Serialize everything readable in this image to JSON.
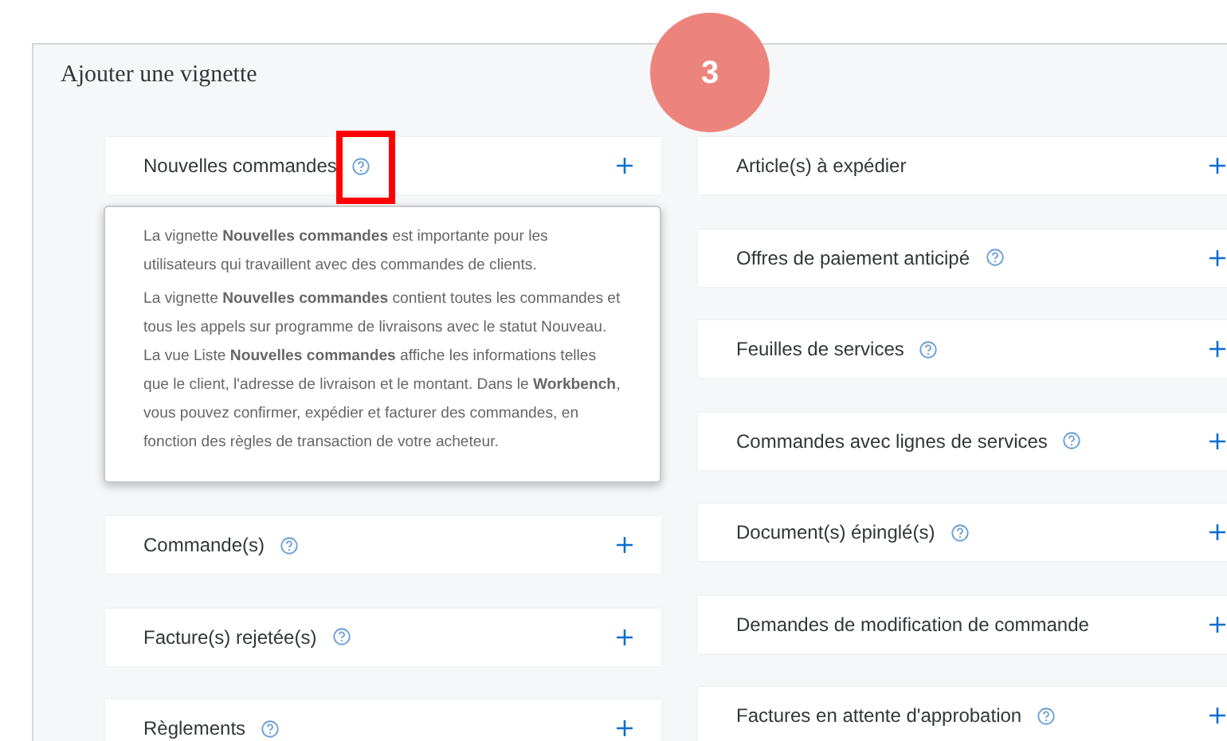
{
  "panel": {
    "title": "Ajouter une vignette"
  },
  "step_badge": "3",
  "tiles_left": [
    {
      "label": "Nouvelles commandes",
      "help": true,
      "highlighted": true
    },
    {
      "label": "Commande(s)",
      "help": true,
      "highlighted": false
    },
    {
      "label": "Facture(s) rejetée(s)",
      "help": true,
      "highlighted": false
    },
    {
      "label": "Règlements",
      "help": true,
      "highlighted": false
    }
  ],
  "tooltip": {
    "paragraphs": [
      "La vignette **Nouvelles commandes** est importante pour les utilisateurs qui travaillent avec des commandes de clients.",
      "La vignette **Nouvelles commandes** contient toutes les commandes et tous les appels sur programme de livraisons avec le statut Nouveau. La vue Liste **Nouvelles commandes** affiche les informations telles que le client, l'adresse de livraison et le montant. Dans le **Workbench**, vous pouvez confirmer, expédier et facturer des commandes, en fonction des règles de transaction de votre acheteur."
    ]
  },
  "tiles_right": [
    {
      "label": "Article(s) à expédier",
      "help": false,
      "highlighted": false
    },
    {
      "label": "Offres de paiement anticipé",
      "help": true,
      "highlighted": false
    },
    {
      "label": "Feuilles de services",
      "help": true,
      "highlighted": false
    },
    {
      "label": "Commandes avec lignes de services",
      "help": true,
      "highlighted": false
    },
    {
      "label": "Document(s) épinglé(s)",
      "help": true,
      "highlighted": false
    },
    {
      "label": "Demandes de modification de commande",
      "help": false,
      "highlighted": false
    },
    {
      "label": "Factures en attente d'approbation",
      "help": true,
      "highlighted": false
    }
  ]
}
